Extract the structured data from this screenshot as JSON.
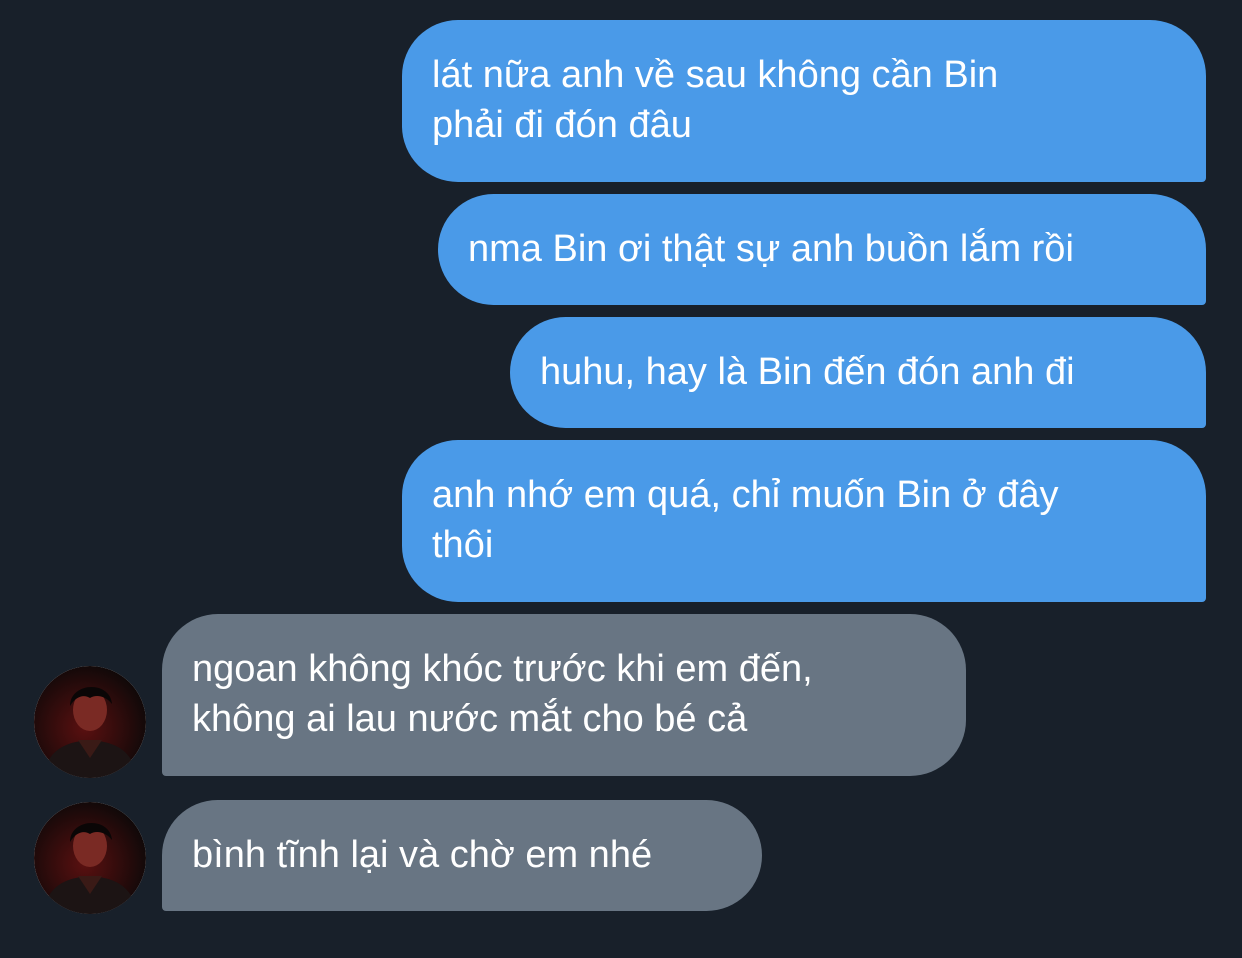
{
  "messages": [
    {
      "direction": "sent",
      "text": "lát nữa anh về sau không cần Bin\nphải đi đón đâu"
    },
    {
      "direction": "sent",
      "text": "nma Bin ơi thật sự anh buồn lắm rồi"
    },
    {
      "direction": "sent",
      "text": "huhu, hay là Bin đến đón anh đi"
    },
    {
      "direction": "sent",
      "text": "anh nhớ em quá, chỉ muốn Bin ở đây\nthôi"
    },
    {
      "direction": "received",
      "text": "ngoan không khóc trước khi em đến,\nkhông ai lau nước mắt cho bé cả"
    },
    {
      "direction": "received",
      "text": "bình tĩnh lại và chờ em nhé"
    }
  ],
  "colors": {
    "background": "#18202a",
    "sent_bubble": "#4a9ae8",
    "received_bubble": "#687583",
    "text": "#ffffff"
  },
  "icons": {
    "contact_avatar": "contact-avatar-photo"
  }
}
